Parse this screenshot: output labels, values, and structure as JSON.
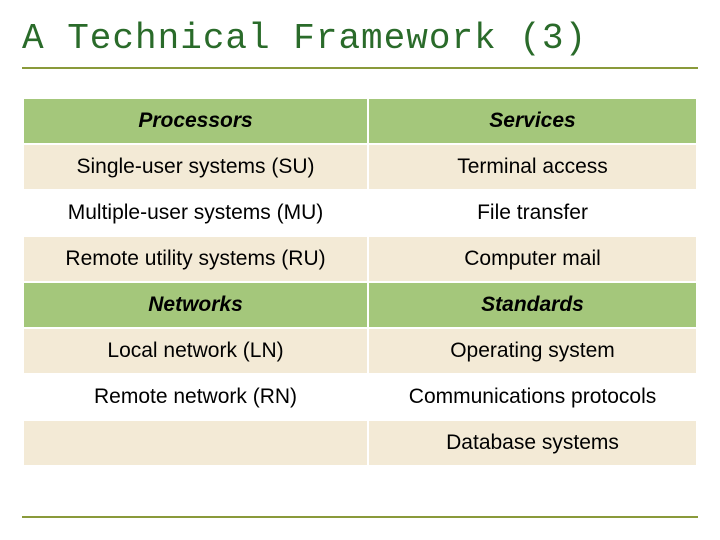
{
  "title": "A Technical Framework (3)",
  "table": {
    "rows": [
      {
        "style": "hdr",
        "left": "Processors",
        "right": "Services"
      },
      {
        "style": "r-odd",
        "left": "Single-user systems (SU)",
        "right": "Terminal access"
      },
      {
        "style": "r-even",
        "left": "Multiple-user systems (MU)",
        "right": "File transfer"
      },
      {
        "style": "r-odd",
        "left": "Remote utility systems (RU)",
        "right": "Computer mail"
      },
      {
        "style": "hdr",
        "left": "Networks",
        "right": "Standards"
      },
      {
        "style": "r-odd",
        "left": "Local network (LN)",
        "right": "Operating system"
      },
      {
        "style": "r-even",
        "left": "Remote network (RN)",
        "right": "Communications protocols"
      },
      {
        "style": "r-odd",
        "left": "",
        "right": "Database systems"
      }
    ]
  }
}
